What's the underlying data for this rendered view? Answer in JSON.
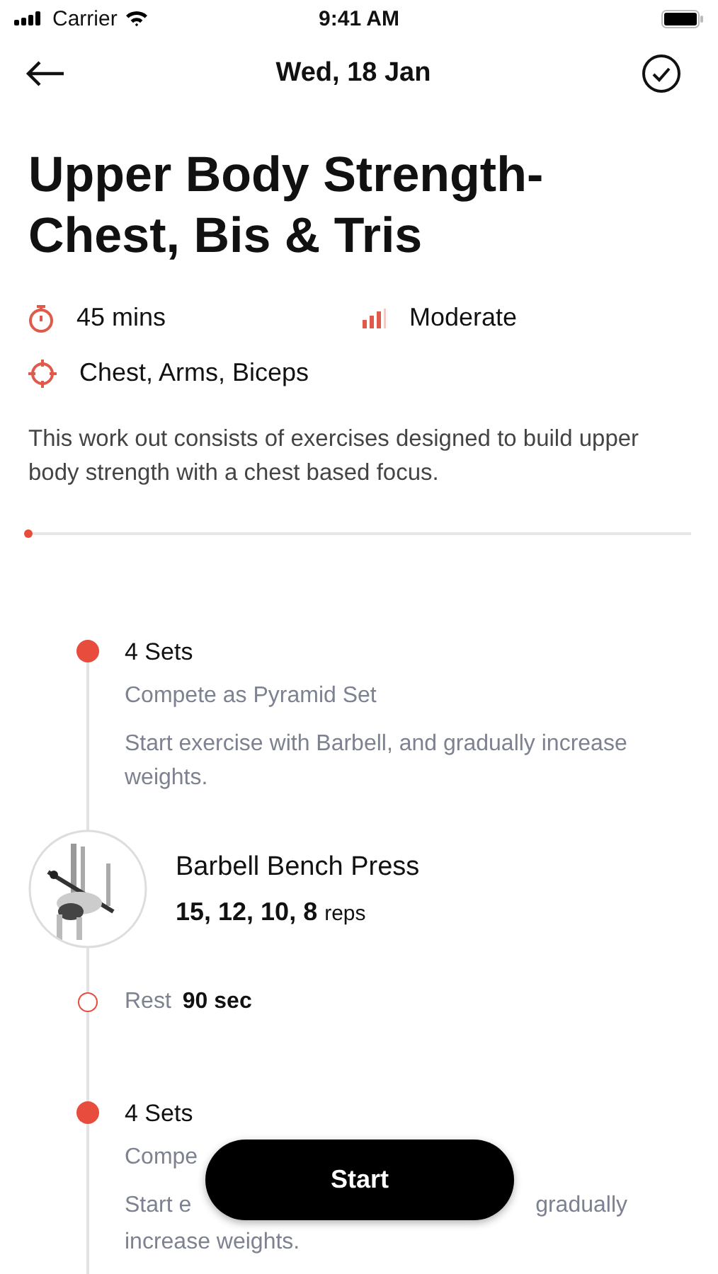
{
  "status_bar": {
    "carrier": "Carrier",
    "time": "9:41 AM"
  },
  "nav": {
    "title": "Wed, 18 Jan"
  },
  "workout": {
    "title": "Upper Body Strength-Chest, Bis & Tris",
    "duration": "45 mins",
    "difficulty": "Moderate",
    "muscles": "Chest, Arms, Biceps",
    "description": "This work out consists of exercises designed to build upper body strength with a chest based focus.",
    "progress": {
      "level": 0
    }
  },
  "timeline": [
    {
      "kind": "set",
      "title": "4 Sets",
      "subtitle": "Compete as Pyramid Set",
      "description": "Start exercise with Barbell, and gradually increase weights."
    },
    {
      "kind": "exercise",
      "name": "Barbell Bench Press",
      "reps": "15, 12, 10, 8",
      "unit": "reps"
    },
    {
      "kind": "rest",
      "label": "Rest",
      "value": "90 sec"
    },
    {
      "kind": "set_covered",
      "title": "4 Sets",
      "subtitle": "Compe",
      "line_left": "Start e",
      "line_right": "gradually",
      "line_2": "increase weights."
    }
  ],
  "start_button": "Start"
}
